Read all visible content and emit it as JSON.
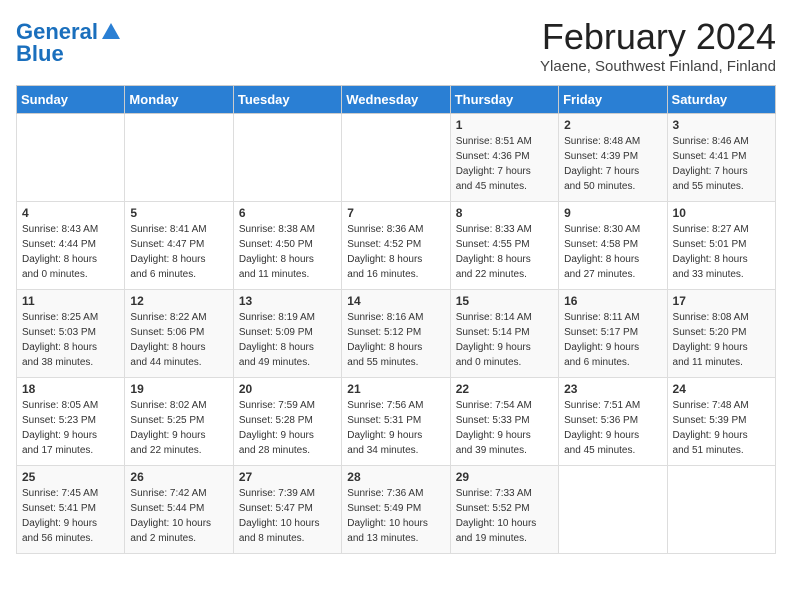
{
  "header": {
    "logo_line1": "General",
    "logo_line2": "Blue",
    "month_year": "February 2024",
    "location": "Ylaene, Southwest Finland, Finland"
  },
  "days_of_week": [
    "Sunday",
    "Monday",
    "Tuesday",
    "Wednesday",
    "Thursday",
    "Friday",
    "Saturday"
  ],
  "weeks": [
    [
      {
        "day": "",
        "info": ""
      },
      {
        "day": "",
        "info": ""
      },
      {
        "day": "",
        "info": ""
      },
      {
        "day": "",
        "info": ""
      },
      {
        "day": "1",
        "info": "Sunrise: 8:51 AM\nSunset: 4:36 PM\nDaylight: 7 hours\nand 45 minutes."
      },
      {
        "day": "2",
        "info": "Sunrise: 8:48 AM\nSunset: 4:39 PM\nDaylight: 7 hours\nand 50 minutes."
      },
      {
        "day": "3",
        "info": "Sunrise: 8:46 AM\nSunset: 4:41 PM\nDaylight: 7 hours\nand 55 minutes."
      }
    ],
    [
      {
        "day": "4",
        "info": "Sunrise: 8:43 AM\nSunset: 4:44 PM\nDaylight: 8 hours\nand 0 minutes."
      },
      {
        "day": "5",
        "info": "Sunrise: 8:41 AM\nSunset: 4:47 PM\nDaylight: 8 hours\nand 6 minutes."
      },
      {
        "day": "6",
        "info": "Sunrise: 8:38 AM\nSunset: 4:50 PM\nDaylight: 8 hours\nand 11 minutes."
      },
      {
        "day": "7",
        "info": "Sunrise: 8:36 AM\nSunset: 4:52 PM\nDaylight: 8 hours\nand 16 minutes."
      },
      {
        "day": "8",
        "info": "Sunrise: 8:33 AM\nSunset: 4:55 PM\nDaylight: 8 hours\nand 22 minutes."
      },
      {
        "day": "9",
        "info": "Sunrise: 8:30 AM\nSunset: 4:58 PM\nDaylight: 8 hours\nand 27 minutes."
      },
      {
        "day": "10",
        "info": "Sunrise: 8:27 AM\nSunset: 5:01 PM\nDaylight: 8 hours\nand 33 minutes."
      }
    ],
    [
      {
        "day": "11",
        "info": "Sunrise: 8:25 AM\nSunset: 5:03 PM\nDaylight: 8 hours\nand 38 minutes."
      },
      {
        "day": "12",
        "info": "Sunrise: 8:22 AM\nSunset: 5:06 PM\nDaylight: 8 hours\nand 44 minutes."
      },
      {
        "day": "13",
        "info": "Sunrise: 8:19 AM\nSunset: 5:09 PM\nDaylight: 8 hours\nand 49 minutes."
      },
      {
        "day": "14",
        "info": "Sunrise: 8:16 AM\nSunset: 5:12 PM\nDaylight: 8 hours\nand 55 minutes."
      },
      {
        "day": "15",
        "info": "Sunrise: 8:14 AM\nSunset: 5:14 PM\nDaylight: 9 hours\nand 0 minutes."
      },
      {
        "day": "16",
        "info": "Sunrise: 8:11 AM\nSunset: 5:17 PM\nDaylight: 9 hours\nand 6 minutes."
      },
      {
        "day": "17",
        "info": "Sunrise: 8:08 AM\nSunset: 5:20 PM\nDaylight: 9 hours\nand 11 minutes."
      }
    ],
    [
      {
        "day": "18",
        "info": "Sunrise: 8:05 AM\nSunset: 5:23 PM\nDaylight: 9 hours\nand 17 minutes."
      },
      {
        "day": "19",
        "info": "Sunrise: 8:02 AM\nSunset: 5:25 PM\nDaylight: 9 hours\nand 22 minutes."
      },
      {
        "day": "20",
        "info": "Sunrise: 7:59 AM\nSunset: 5:28 PM\nDaylight: 9 hours\nand 28 minutes."
      },
      {
        "day": "21",
        "info": "Sunrise: 7:56 AM\nSunset: 5:31 PM\nDaylight: 9 hours\nand 34 minutes."
      },
      {
        "day": "22",
        "info": "Sunrise: 7:54 AM\nSunset: 5:33 PM\nDaylight: 9 hours\nand 39 minutes."
      },
      {
        "day": "23",
        "info": "Sunrise: 7:51 AM\nSunset: 5:36 PM\nDaylight: 9 hours\nand 45 minutes."
      },
      {
        "day": "24",
        "info": "Sunrise: 7:48 AM\nSunset: 5:39 PM\nDaylight: 9 hours\nand 51 minutes."
      }
    ],
    [
      {
        "day": "25",
        "info": "Sunrise: 7:45 AM\nSunset: 5:41 PM\nDaylight: 9 hours\nand 56 minutes."
      },
      {
        "day": "26",
        "info": "Sunrise: 7:42 AM\nSunset: 5:44 PM\nDaylight: 10 hours\nand 2 minutes."
      },
      {
        "day": "27",
        "info": "Sunrise: 7:39 AM\nSunset: 5:47 PM\nDaylight: 10 hours\nand 8 minutes."
      },
      {
        "day": "28",
        "info": "Sunrise: 7:36 AM\nSunset: 5:49 PM\nDaylight: 10 hours\nand 13 minutes."
      },
      {
        "day": "29",
        "info": "Sunrise: 7:33 AM\nSunset: 5:52 PM\nDaylight: 10 hours\nand 19 minutes."
      },
      {
        "day": "",
        "info": ""
      },
      {
        "day": "",
        "info": ""
      }
    ]
  ]
}
